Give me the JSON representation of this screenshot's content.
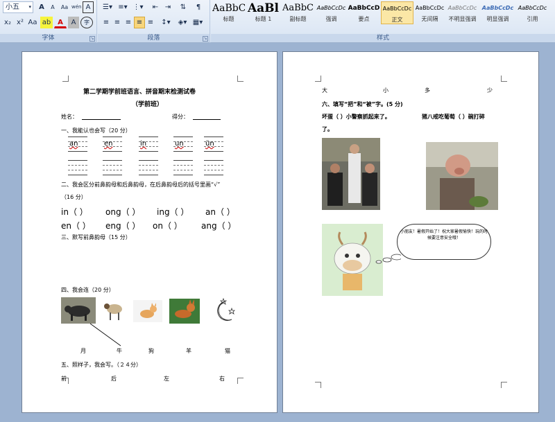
{
  "ribbon": {
    "font_size_value": "小五",
    "font_group_label": "字体",
    "paragraph_group_label": "段落",
    "styles_group_label": "样式",
    "buttons": {
      "grow_font": "A",
      "shrink_font": "A",
      "clear_format": "Aa",
      "phonetic": "wén",
      "border_char": "A",
      "subscript": "x₂",
      "superscript": "x²",
      "change_case": "Aa",
      "highlight": "ab",
      "font_color": "A",
      "char_shade": "A",
      "enclose": "字"
    },
    "styles": [
      {
        "preview": "AaBbC",
        "name": "标题"
      },
      {
        "preview": "AaBl",
        "name": "标题 1"
      },
      {
        "preview": "AaBbC",
        "name": "副标题"
      },
      {
        "preview": "AaBbCcDc",
        "name": "强调"
      },
      {
        "preview": "AaBbCcD",
        "name": "要点"
      },
      {
        "preview": "AaBbCcDc",
        "name": "正文"
      },
      {
        "preview": "AaBbCcDc",
        "name": "无间隔"
      },
      {
        "preview": "AaBbCcDc",
        "name": "不明显强调"
      },
      {
        "preview": "AaBbCcDc",
        "name": "明显强调"
      },
      {
        "preview": "AaBbCcDc",
        "name": "引用"
      }
    ]
  },
  "page1": {
    "title": "第二学期学前班语言、拼音期末检测试卷",
    "subtitle": "（学前班）",
    "name_label": "姓名：",
    "score_label": "得分：",
    "q1": "一、我能认也会写（20 分）",
    "q1_items": [
      "an",
      "en",
      "in",
      "un",
      "ün"
    ],
    "q2": "二、我会区分前鼻韵母和后鼻韵母，在后鼻韵母后的括号里画“√”",
    "q2_points": "（16 分）",
    "q2_row1": [
      "in（  ）",
      "ong（  ）",
      "ing（  ）",
      "an（  ）"
    ],
    "q2_row2": [
      "en（  ）",
      "eng（  ）",
      "on（  ）",
      "ang（  ）"
    ],
    "q3": "三、默写前鼻韵母（15 分）",
    "q4": "四、我会连（20 分）",
    "q4_words": [
      "月",
      "牛",
      "狗",
      "羊",
      "猫"
    ],
    "q5": "五、照样子，我会写。（２４分）",
    "q5_words": [
      "前",
      "后",
      "左",
      "右"
    ]
  },
  "page2": {
    "top_words": [
      "大",
      "小",
      "多",
      "少"
    ],
    "q6": "六、填写“把”和“被”字。(5 分)",
    "q6_line1_a": "坏蛋（    ）小警察抓起来了。",
    "q6_line1_b": "猪八戒吃葡萄（    ）碗打碎",
    "q6_line2": "了。",
    "bubble_text": "小朋友！暑假开始了！祝大家暑假愉快！玩的时候要注意安全哦！"
  }
}
